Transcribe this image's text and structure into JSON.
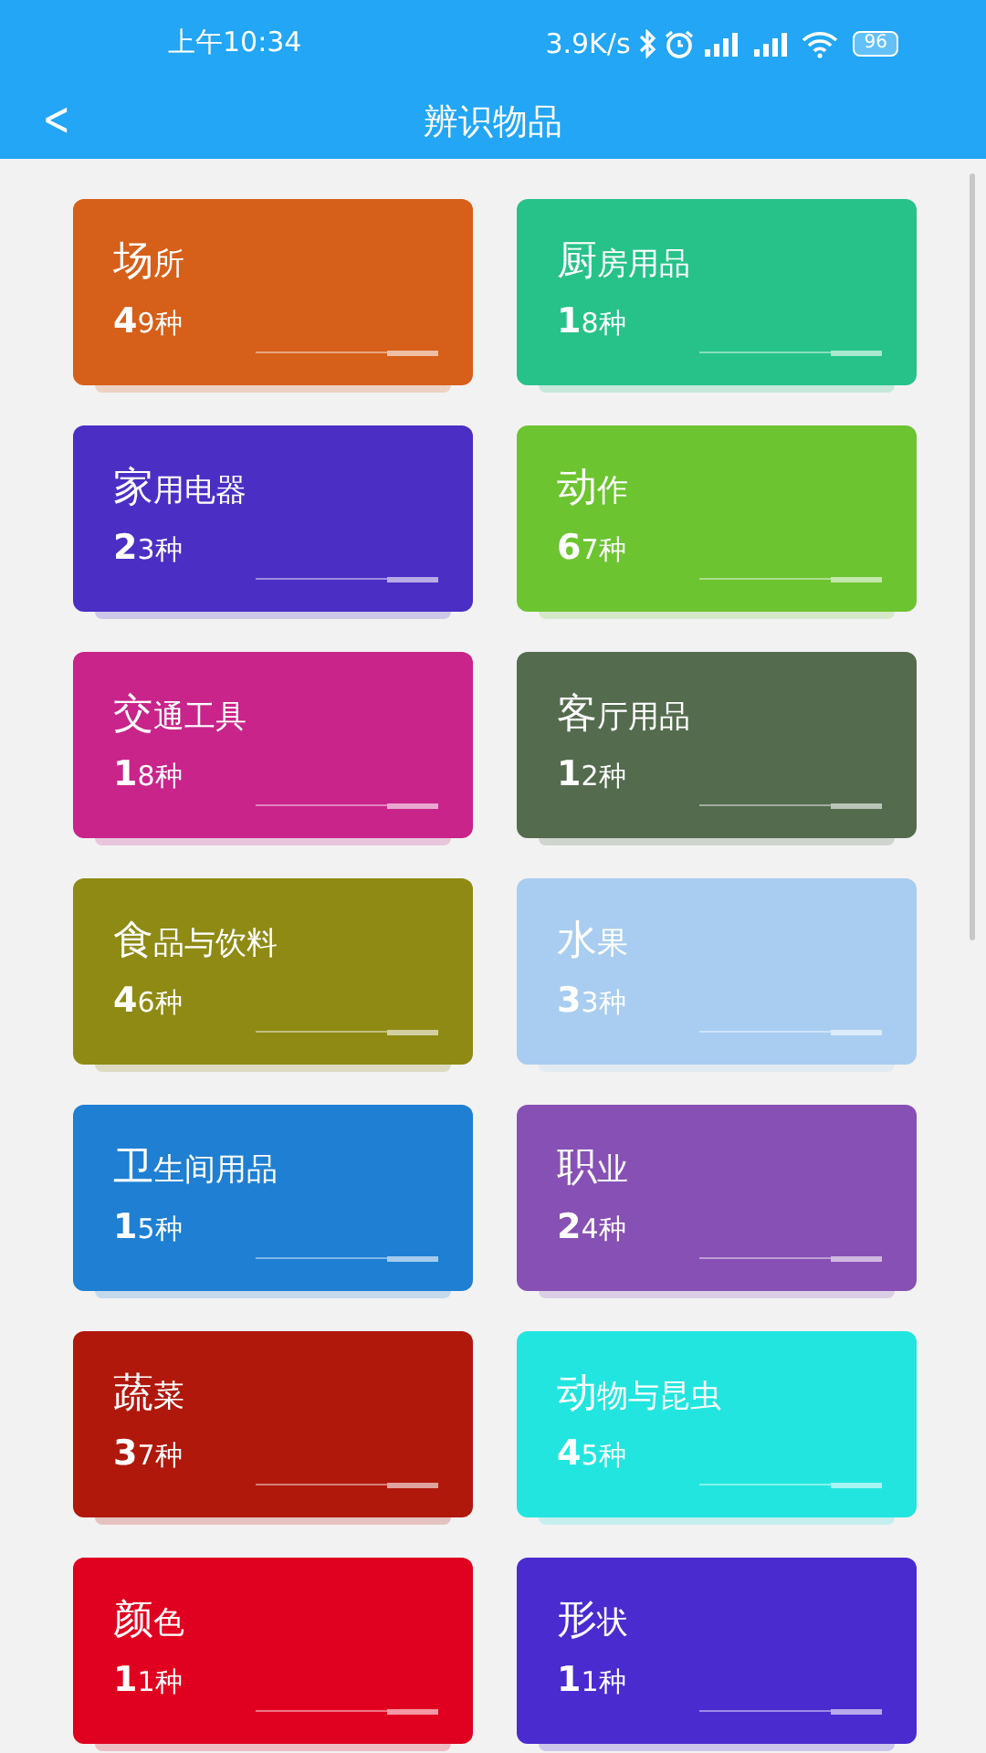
{
  "status_bar": {
    "time": "上午10:34",
    "speed": "3.9K/s",
    "battery": "96"
  },
  "header": {
    "back": "<",
    "title": "辨识物品"
  },
  "categories": [
    {
      "title": "场所",
      "count": "49种",
      "color": "#d65f19"
    },
    {
      "title": "厨房用品",
      "count": "18种",
      "color": "#26c28a"
    },
    {
      "title": "家用电器",
      "count": "23种",
      "color": "#4b2fc4"
    },
    {
      "title": "动作",
      "count": "67种",
      "color": "#6cc430"
    },
    {
      "title": "交通工具",
      "count": "18种",
      "color": "#c8248a"
    },
    {
      "title": "客厅用品",
      "count": "12种",
      "color": "#546b4e"
    },
    {
      "title": "食品与饮料",
      "count": "46种",
      "color": "#8e8a14"
    },
    {
      "title": "水果",
      "count": "33种",
      "color": "#a8cdf0"
    },
    {
      "title": "卫生间用品",
      "count": "15种",
      "color": "#1e7fd3"
    },
    {
      "title": "职业",
      "count": "24种",
      "color": "#8750b5"
    },
    {
      "title": "蔬菜",
      "count": "37种",
      "color": "#b0180c"
    },
    {
      "title": "动物与昆虫",
      "count": "45种",
      "color": "#22e5df"
    },
    {
      "title": "颜色",
      "count": "11种",
      "color": "#e0001f"
    },
    {
      "title": "形状",
      "count": "11种",
      "color": "#4a2bd0"
    }
  ]
}
